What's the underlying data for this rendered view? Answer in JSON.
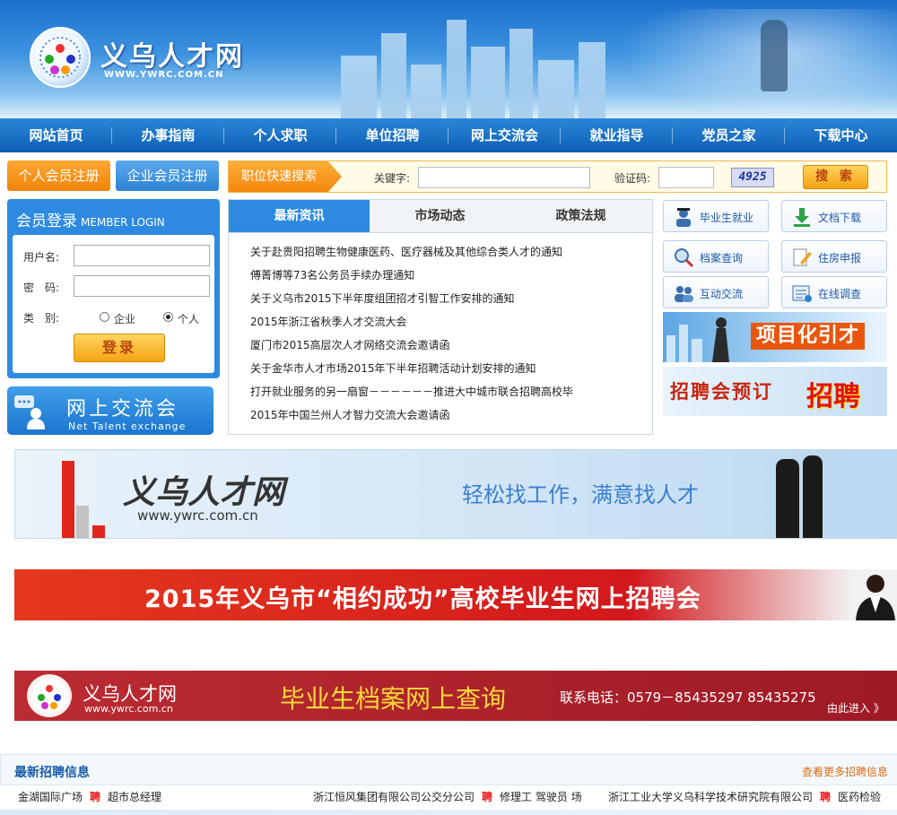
{
  "header": {
    "site_name": "义乌人才网",
    "site_url": "WWW.YWRC.COM.CN"
  },
  "nav": [
    "网站首页",
    "办事指南",
    "个人求职",
    "单位招聘",
    "网上交流会",
    "就业指导",
    "党员之家",
    "下载中心"
  ],
  "register": {
    "personal": "个人会员注册",
    "company": "企业会员注册"
  },
  "search": {
    "title": "职位快速搜索",
    "keyword_label": "关键字:",
    "captcha_label": "验证码:",
    "captcha": "4925",
    "button": "搜 索"
  },
  "login": {
    "title": "会员登录",
    "title_en": "MEMBER LOGIN",
    "username_label": "用户名:",
    "password_label": "密　码:",
    "type_label": "类　别:",
    "opt_company": "企业",
    "opt_personal": "个人",
    "button": "登录"
  },
  "exchange": {
    "cn": "网上交流会",
    "en": "Net  Talent  exchange"
  },
  "news": {
    "tabs": [
      "最新资讯",
      "市场动态",
      "政策法规"
    ],
    "items": [
      "关于赴贵阳招聘生物健康医药、医疗器械及其他综合类人才的通知",
      "傅菁博等73名公务员手续办理通知",
      "关于义乌市2015下半年度组团招才引智工作安排的通知",
      "2015年浙江省秋季人才交流大会",
      "厦门市2015高层次人才网络交流会邀请函",
      "关于金华市人才市场2015年下半年招聘活动计划安排的通知",
      "打开就业服务的另一扇窗－－－－－－推进大中城市联合招聘高校毕",
      "2015年中国兰州人才智力交流大会邀请函"
    ]
  },
  "side": [
    {
      "label": "毕业生就业",
      "icon": "graduate-icon"
    },
    {
      "label": "文档下载",
      "icon": "download-icon"
    },
    {
      "label": "档案查询",
      "icon": "magnifier-icon"
    },
    {
      "label": "住房申报",
      "icon": "pencil-icon"
    },
    {
      "label": "互动交流",
      "icon": "people-icon"
    },
    {
      "label": "在线调查",
      "icon": "survey-icon"
    }
  ],
  "ads": {
    "project": "项目化引才",
    "fair": "招聘会预订",
    "fair_big": "招聘"
  },
  "banner1": {
    "name": "义乌人才网",
    "url": "www.ywrc.com.cn",
    "slogan": "轻松找工作，满意找人才"
  },
  "banner2": {
    "text": "2015年义乌市“相约成功”高校毕业生网上招聘会"
  },
  "banner3": {
    "name": "义乌人才网",
    "url": "www.ywrc.com.cn",
    "main": "毕业生档案网上查询",
    "phone": "联系电话：0579－85435297  85435275",
    "enter": "由此进入 》"
  },
  "jobs": {
    "title": "最新招聘信息",
    "more": "查看更多招聘信息",
    "rows": [
      {
        "company": "金湖国际广场",
        "tag": "聘",
        "positions": "超市总经理"
      },
      {
        "company": "浙江恒风集团有限公司公交分公司",
        "tag": "聘",
        "positions": "修理工 驾驶员 场"
      },
      {
        "company": "浙江工业大学义乌科学技术研究院有限公司",
        "tag": "聘",
        "positions": "医药检验"
      }
    ]
  },
  "colors": {
    "brand_blue": "#2d8ae0",
    "accent_orange": "#f0850a",
    "banner_red": "#d2181c"
  }
}
